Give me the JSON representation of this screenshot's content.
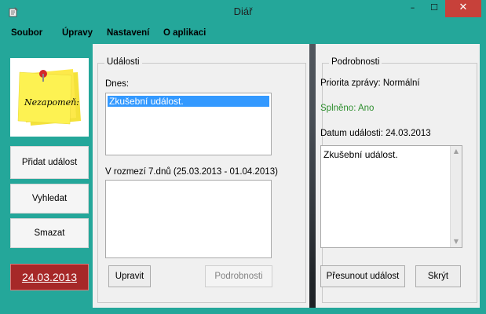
{
  "window": {
    "title": "Diář"
  },
  "controls": {
    "minimize": "–",
    "maximize": "☐",
    "close": "✕"
  },
  "menu": [
    "Soubor",
    "Úpravy",
    "Nastavení",
    "O aplikaci"
  ],
  "sidebar": {
    "sticky_note": "Nezapomeň:",
    "buttons": [
      "Přidat událost",
      "Vyhledat",
      "Smazat"
    ],
    "date": "24.03.2013"
  },
  "events": {
    "group_title": "Události",
    "today_label": "Dnes:",
    "today_items": [
      "Zkušební událost."
    ],
    "range_label": "V rozmezí 7.dnů (25.03.2013 - 01.04.2013)",
    "range_items": [],
    "edit_button": "Upravit",
    "details_button": "Podrobnosti"
  },
  "details": {
    "group_title": "Podrobnosti",
    "priority": "Priorita zprávy: Normální",
    "completed": "Splněno: Ano",
    "event_date": "Datum události: 24.03.2013",
    "text": "Zkušební událost.",
    "move_button": "Přesunout událost",
    "hide_button": "Skrýt"
  },
  "colors": {
    "accent": "#24a79a",
    "date_badge": "#a62828",
    "completed_text": "#2f8f2f",
    "selection": "#3399ff",
    "sticky_note": "#fdf252"
  }
}
